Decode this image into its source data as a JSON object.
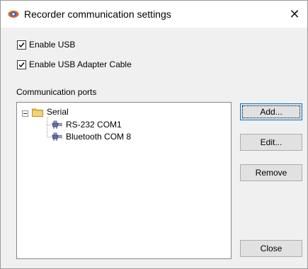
{
  "window": {
    "title": "Recorder communication settings",
    "close_glyph": "✕"
  },
  "options": {
    "enable_usb": {
      "label": "Enable USB",
      "checked": true
    },
    "enable_usb_adapter": {
      "label": "Enable USB Adapter Cable",
      "checked": true
    }
  },
  "ports": {
    "section_label": "Communication ports",
    "tree": {
      "root": {
        "label": "Serial",
        "expanded": true,
        "icon": "folder-icon",
        "toggle_icon": "collapse-minus-icon"
      },
      "children": [
        {
          "label": "RS-232 COM1",
          "icon": "serial-port-icon"
        },
        {
          "label": "Bluetooth COM 8",
          "icon": "serial-port-icon"
        }
      ]
    }
  },
  "buttons": {
    "add": "Add...",
    "edit": "Edit...",
    "remove": "Remove",
    "close": "Close"
  },
  "colors": {
    "accent_focus": "#0078d7",
    "folder": "#e8c15c",
    "port_icon": "#6a6fa8"
  }
}
